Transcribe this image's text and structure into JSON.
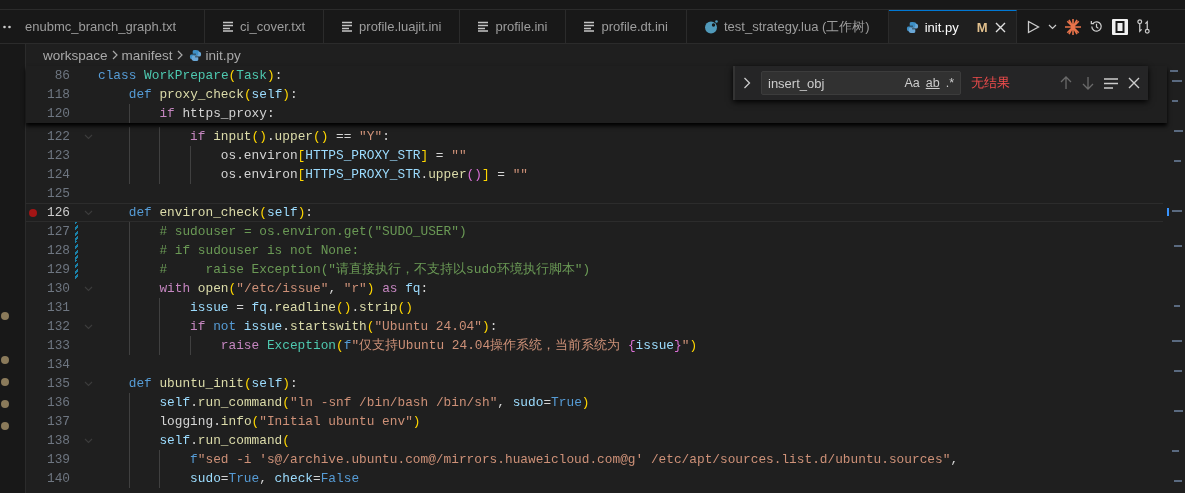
{
  "tabs": [
    {
      "label": "enubmc_branch_graph.txt",
      "kind": "clipped",
      "selected": false
    },
    {
      "label": "ci_cover.txt",
      "kind": "text",
      "selected": false
    },
    {
      "label": "profile.luajit.ini",
      "kind": "text",
      "selected": false
    },
    {
      "label": "profile.ini",
      "kind": "text",
      "selected": false
    },
    {
      "label": "profile.dt.ini",
      "kind": "text",
      "selected": false
    },
    {
      "label": "test_strategy.lua (工作树)",
      "kind": "lua",
      "selected": false
    },
    {
      "label": "init.py",
      "kind": "python",
      "selected": true,
      "status": "M"
    }
  ],
  "breadcrumb": [
    {
      "label": "workspace",
      "kind": "folder"
    },
    {
      "label": "manifest",
      "kind": "folder"
    },
    {
      "label": "init.py",
      "kind": "python"
    }
  ],
  "sticky_lines": [
    {
      "number": "86",
      "tokens": [
        {
          "t": "class",
          "kind": "keyword"
        },
        {
          "t": " WorkPrepare",
          "kind": "class"
        },
        {
          "t": "(",
          "kind": "bracket"
        },
        {
          "t": "Task",
          "kind": "class"
        },
        {
          "t": ")",
          "kind": "bracket"
        },
        {
          "t": ":",
          "kind": "plain"
        }
      ]
    },
    {
      "number": "118",
      "tokens": [
        {
          "t": "    def",
          "kind": "keyword"
        },
        {
          "t": " proxy_check",
          "kind": "function"
        },
        {
          "t": "(",
          "kind": "bracket"
        },
        {
          "t": "self",
          "kind": "variable"
        },
        {
          "t": ")",
          "kind": "bracket"
        },
        {
          "t": ":",
          "kind": "plain"
        }
      ]
    },
    {
      "number": "120",
      "tokens": [
        {
          "t": "        if",
          "kind": "control"
        },
        {
          "t": " https_proxy:",
          "kind": "plain"
        }
      ]
    }
  ],
  "lines": [
    {
      "number": "122",
      "current": false,
      "breakpoint": false,
      "modified": false,
      "foldable": true,
      "tokens": [
        {
          "t": "            if",
          "kind": "control"
        },
        {
          "t": " input",
          "kind": "function"
        },
        {
          "t": "()",
          "kind": "bracket"
        },
        {
          "t": ".",
          "kind": "plain"
        },
        {
          "t": "upper",
          "kind": "function"
        },
        {
          "t": "()",
          "kind": "bracket"
        },
        {
          "t": " ==",
          "kind": "plain"
        },
        {
          "t": " \"Y\"",
          "kind": "string"
        },
        {
          "t": ":",
          "kind": "plain"
        }
      ]
    },
    {
      "number": "123",
      "current": false,
      "breakpoint": false,
      "modified": false,
      "foldable": false,
      "tokens": [
        {
          "t": "                os.environ",
          "kind": "plain"
        },
        {
          "t": "[",
          "kind": "bracket"
        },
        {
          "t": "HTTPS_PROXY_STR",
          "kind": "variable"
        },
        {
          "t": "]",
          "kind": "bracket"
        },
        {
          "t": " =",
          "kind": "plain"
        },
        {
          "t": " \"\"",
          "kind": "string"
        }
      ]
    },
    {
      "number": "124",
      "current": false,
      "breakpoint": false,
      "modified": false,
      "foldable": false,
      "tokens": [
        {
          "t": "                os.environ",
          "kind": "plain"
        },
        {
          "t": "[",
          "kind": "bracket"
        },
        {
          "t": "HTTPS_PROXY_STR",
          "kind": "variable"
        },
        {
          "t": ".",
          "kind": "plain"
        },
        {
          "t": "upper",
          "kind": "function"
        },
        {
          "t": "()",
          "kind": "bracket2"
        },
        {
          "t": "]",
          "kind": "bracket"
        },
        {
          "t": " =",
          "kind": "plain"
        },
        {
          "t": " \"\"",
          "kind": "string"
        }
      ]
    },
    {
      "number": "125",
      "current": false,
      "breakpoint": false,
      "modified": false,
      "foldable": false
    },
    {
      "number": "126",
      "current": true,
      "breakpoint": true,
      "modified": false,
      "foldable": true,
      "tokens": [
        {
          "t": "    def",
          "kind": "keyword"
        },
        {
          "t": " environ_check",
          "kind": "function"
        },
        {
          "t": "(",
          "kind": "bracket"
        },
        {
          "t": "self",
          "kind": "variable"
        },
        {
          "t": ")",
          "kind": "bracket"
        },
        {
          "t": ":",
          "kind": "plain"
        }
      ]
    },
    {
      "number": "127",
      "current": false,
      "breakpoint": false,
      "modified": true,
      "foldable": false,
      "tokens": [
        {
          "t": "        # sudouser = os.environ.get(\"SUDO_USER\")",
          "kind": "comment"
        }
      ]
    },
    {
      "number": "128",
      "current": false,
      "breakpoint": false,
      "modified": true,
      "foldable": false,
      "tokens": [
        {
          "t": "        # if sudouser is not None:",
          "kind": "comment"
        }
      ]
    },
    {
      "number": "129",
      "current": false,
      "breakpoint": false,
      "modified": true,
      "foldable": false,
      "tokens": [
        {
          "t": "        #     raise Exception(\"请直接执行，不支持以sudo环境执行脚本\")",
          "kind": "comment"
        }
      ]
    },
    {
      "number": "130",
      "current": false,
      "breakpoint": false,
      "modified": false,
      "foldable": true,
      "tokens": [
        {
          "t": "        with",
          "kind": "control"
        },
        {
          "t": " open",
          "kind": "function"
        },
        {
          "t": "(",
          "kind": "bracket"
        },
        {
          "t": "\"/etc/issue\"",
          "kind": "string"
        },
        {
          "t": ",",
          "kind": "plain"
        },
        {
          "t": " \"r\"",
          "kind": "string"
        },
        {
          "t": ")",
          "kind": "bracket"
        },
        {
          "t": " as",
          "kind": "control"
        },
        {
          "t": " fq",
          "kind": "variable"
        },
        {
          "t": ":",
          "kind": "plain"
        }
      ]
    },
    {
      "number": "131",
      "current": false,
      "breakpoint": false,
      "modified": false,
      "foldable": false,
      "tokens": [
        {
          "t": "            issue",
          "kind": "variable"
        },
        {
          "t": " =",
          "kind": "plain"
        },
        {
          "t": " fq",
          "kind": "variable"
        },
        {
          "t": ".",
          "kind": "plain"
        },
        {
          "t": "readline",
          "kind": "function"
        },
        {
          "t": "()",
          "kind": "bracket"
        },
        {
          "t": ".",
          "kind": "plain"
        },
        {
          "t": "strip",
          "kind": "function"
        },
        {
          "t": "()",
          "kind": "bracket"
        }
      ]
    },
    {
      "number": "132",
      "current": false,
      "breakpoint": false,
      "modified": false,
      "foldable": true,
      "tokens": [
        {
          "t": "            if",
          "kind": "control"
        },
        {
          "t": " not",
          "kind": "keyword"
        },
        {
          "t": " issue",
          "kind": "variable"
        },
        {
          "t": ".",
          "kind": "plain"
        },
        {
          "t": "startswith",
          "kind": "function"
        },
        {
          "t": "(",
          "kind": "bracket"
        },
        {
          "t": "\"Ubuntu 24.04\"",
          "kind": "string"
        },
        {
          "t": ")",
          "kind": "bracket"
        },
        {
          "t": ":",
          "kind": "plain"
        }
      ]
    },
    {
      "number": "133",
      "current": false,
      "breakpoint": false,
      "modified": false,
      "foldable": false,
      "tokens": [
        {
          "t": "                raise",
          "kind": "control"
        },
        {
          "t": " Exception",
          "kind": "class"
        },
        {
          "t": "(",
          "kind": "bracket"
        },
        {
          "t": "f",
          "kind": "keyword"
        },
        {
          "t": "\"仅支持Ubuntu 24.04操作系统，当前系统为 ",
          "kind": "string"
        },
        {
          "t": "{",
          "kind": "bracket2"
        },
        {
          "t": "issue",
          "kind": "variable"
        },
        {
          "t": "}",
          "kind": "bracket2"
        },
        {
          "t": "\"",
          "kind": "string"
        },
        {
          "t": ")",
          "kind": "bracket"
        }
      ]
    },
    {
      "number": "134",
      "current": false,
      "breakpoint": false,
      "modified": false,
      "foldable": false
    },
    {
      "number": "135",
      "current": false,
      "breakpoint": false,
      "modified": false,
      "foldable": true,
      "tokens": [
        {
          "t": "    def",
          "kind": "keyword"
        },
        {
          "t": " ubuntu_init",
          "kind": "function"
        },
        {
          "t": "(",
          "kind": "bracket"
        },
        {
          "t": "self",
          "kind": "variable"
        },
        {
          "t": ")",
          "kind": "bracket"
        },
        {
          "t": ":",
          "kind": "plain"
        }
      ]
    },
    {
      "number": "136",
      "current": false,
      "breakpoint": false,
      "modified": false,
      "foldable": false,
      "tokens": [
        {
          "t": "        self",
          "kind": "variable"
        },
        {
          "t": ".",
          "kind": "plain"
        },
        {
          "t": "run_command",
          "kind": "function"
        },
        {
          "t": "(",
          "kind": "bracket"
        },
        {
          "t": "\"ln -snf /bin/bash /bin/sh\"",
          "kind": "string"
        },
        {
          "t": ",",
          "kind": "plain"
        },
        {
          "t": " sudo",
          "kind": "variable"
        },
        {
          "t": "=",
          "kind": "plain"
        },
        {
          "t": "True",
          "kind": "keyword"
        },
        {
          "t": ")",
          "kind": "bracket"
        }
      ]
    },
    {
      "number": "137",
      "current": false,
      "breakpoint": false,
      "modified": false,
      "foldable": false,
      "tokens": [
        {
          "t": "        logging.",
          "kind": "plain"
        },
        {
          "t": "info",
          "kind": "function"
        },
        {
          "t": "(",
          "kind": "bracket"
        },
        {
          "t": "\"Initial ubuntu env\"",
          "kind": "string"
        },
        {
          "t": ")",
          "kind": "bracket"
        }
      ]
    },
    {
      "number": "138",
      "current": false,
      "breakpoint": false,
      "modified": false,
      "foldable": true,
      "tokens": [
        {
          "t": "        self",
          "kind": "variable"
        },
        {
          "t": ".",
          "kind": "plain"
        },
        {
          "t": "run_command",
          "kind": "function"
        },
        {
          "t": "(",
          "kind": "bracket"
        }
      ]
    },
    {
      "number": "139",
      "current": false,
      "breakpoint": false,
      "modified": false,
      "foldable": false,
      "tokens": [
        {
          "t": "            f",
          "kind": "keyword"
        },
        {
          "t": "\"sed -i 's@/archive.ubuntu.com@/mirrors.huaweicloud.com@g' /etc/apt/sources.list.d/ubuntu.sources\"",
          "kind": "string"
        },
        {
          "t": ",",
          "kind": "plain"
        }
      ]
    },
    {
      "number": "140",
      "current": false,
      "breakpoint": false,
      "modified": false,
      "foldable": false,
      "tokens": [
        {
          "t": "            sudo",
          "kind": "variable"
        },
        {
          "t": "=",
          "kind": "plain"
        },
        {
          "t": "True",
          "kind": "keyword"
        },
        {
          "t": ",",
          "kind": "plain"
        },
        {
          "t": " check",
          "kind": "variable"
        },
        {
          "t": "=",
          "kind": "plain"
        },
        {
          "t": "False",
          "kind": "keyword"
        }
      ]
    }
  ],
  "find_widget": {
    "query": "insert_obj",
    "options": [
      "Aa",
      "ab",
      ".*"
    ],
    "result": "无结果"
  }
}
